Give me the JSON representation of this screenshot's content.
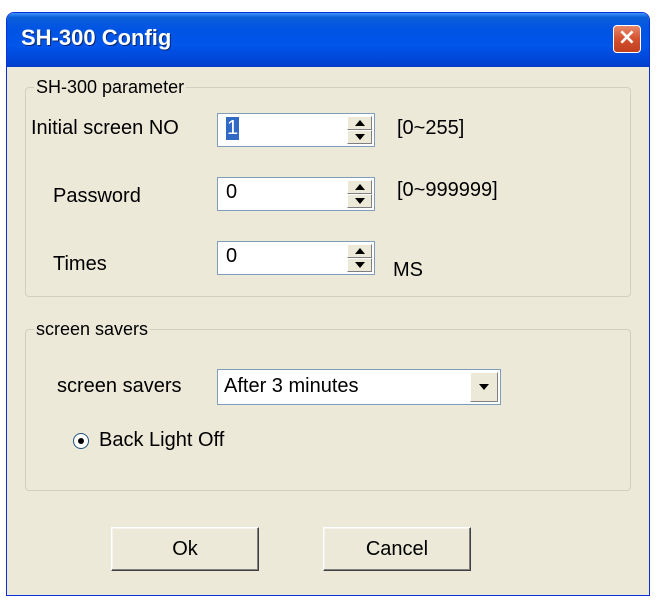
{
  "window": {
    "title": "SH-300 Config",
    "close_symbol": "×"
  },
  "parameter_group": {
    "legend": "SH-300 parameter",
    "initial_screen": {
      "label": "Initial screen NO",
      "value": "1",
      "range": "[0~255]"
    },
    "password": {
      "label": "Password",
      "value": "0",
      "range": "[0~999999]"
    },
    "times": {
      "label": "Times",
      "value": "0",
      "unit": "MS"
    }
  },
  "screensaver_group": {
    "legend": "screen savers",
    "select_label": "screen savers",
    "select_value": "After 3 minutes",
    "radio_label": "Back Light Off",
    "radio_checked": true
  },
  "buttons": {
    "ok": "Ok",
    "cancel": "Cancel"
  },
  "colors": {
    "title_bar": "#0054e3",
    "dialog_bg": "#ece9d8",
    "close_button": "#d4502f",
    "selection": "#316ac5"
  },
  "icons": {
    "close": "close-icon",
    "spin_up": "chevron-up-icon",
    "spin_down": "chevron-down-icon",
    "dropdown": "chevron-down-icon"
  }
}
